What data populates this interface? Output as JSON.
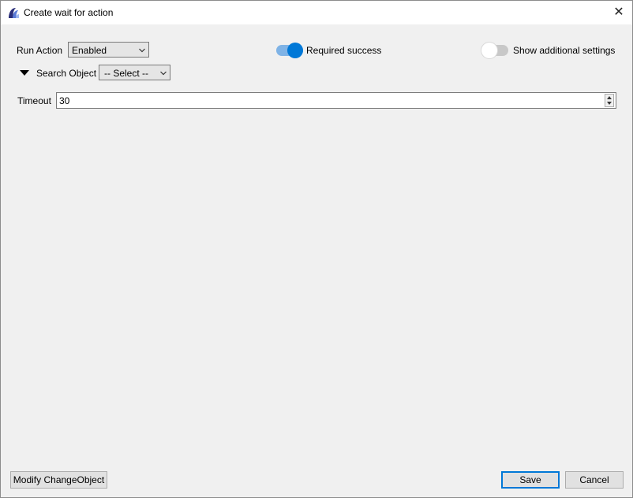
{
  "window": {
    "title": "Create wait for action",
    "close_symbol": "✕"
  },
  "run_action": {
    "label": "Run Action",
    "value": "Enabled"
  },
  "required_success": {
    "label": "Required success",
    "on": true,
    "on_color": "#0078d7",
    "track_color": "#7fb3e6"
  },
  "additional_settings": {
    "label": "Show additional settings",
    "on": false,
    "off_color": "#c8c8c8"
  },
  "search_object": {
    "label": "Search Object",
    "value": "-- Select --"
  },
  "timeout": {
    "label": "Timeout",
    "value": "30"
  },
  "footer": {
    "modify_label": "Modify ChangeObject",
    "save_label": "Save",
    "cancel_label": "Cancel"
  },
  "icons": [
    "app-logo-icon",
    "close-icon",
    "chevron-down-icon",
    "expand-triangle-icon",
    "spin-up-icon",
    "spin-down-icon"
  ]
}
